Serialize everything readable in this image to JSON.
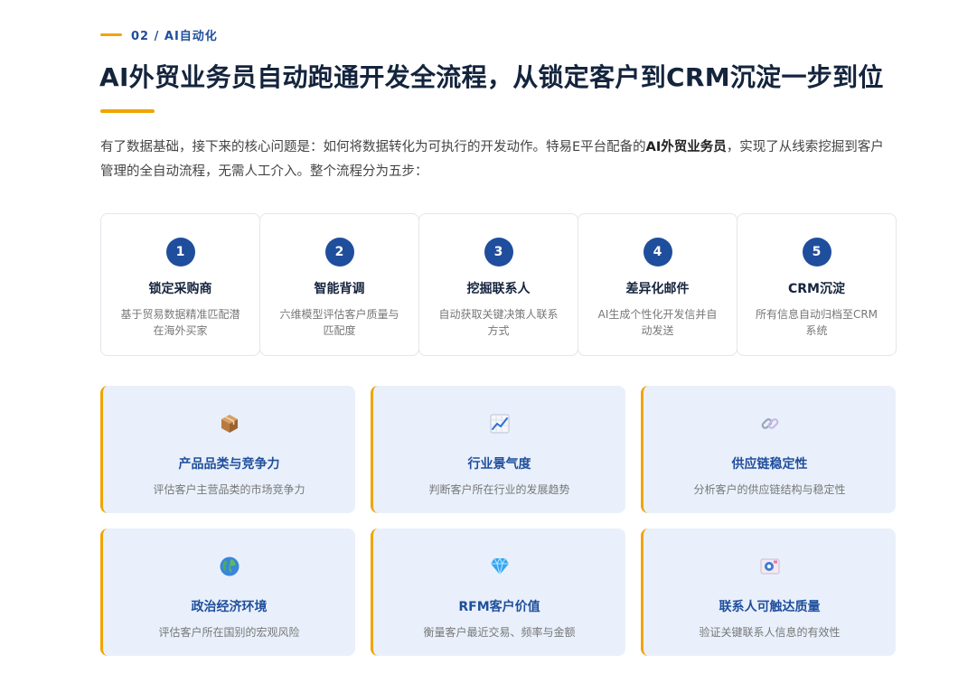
{
  "section": {
    "label": "02 / AI自动化"
  },
  "title": "AI外贸业务员自动跑通开发全流程，从锁定客户到CRM沉淀一步到位",
  "intro": {
    "before": "有了数据基础，接下来的核心问题是：如何将数据转化为可执行的开发动作。特易E平台配备的",
    "bold": "AI外贸业务员",
    "after": "，实现了从线索挖掘到客户管理的全自动流程，无需人工介入。整个流程分为五步："
  },
  "steps": [
    {
      "num": "1",
      "title": "锁定采购商",
      "desc": "基于贸易数据精准匹配潜在海外买家"
    },
    {
      "num": "2",
      "title": "智能背调",
      "desc": "六维模型评估客户质量与匹配度"
    },
    {
      "num": "3",
      "title": "挖掘联系人",
      "desc": "自动获取关键决策人联系方式"
    },
    {
      "num": "4",
      "title": "差异化邮件",
      "desc": "AI生成个性化开发信并自动发送"
    },
    {
      "num": "5",
      "title": "CRM沉淀",
      "desc": "所有信息自动归档至CRM系统"
    }
  ],
  "cards": [
    {
      "icon": "package-icon",
      "title": "产品品类与竞争力",
      "desc": "评估客户主营品类的市场竞争力"
    },
    {
      "icon": "trend-chart-icon",
      "title": "行业景气度",
      "desc": "判断客户所在行业的发展趋势"
    },
    {
      "icon": "chain-link-icon",
      "title": "供应链稳定性",
      "desc": "分析客户的供应链结构与稳定性"
    },
    {
      "icon": "globe-icon",
      "title": "政治经济环境",
      "desc": "评估客户所在国别的宏观风险"
    },
    {
      "icon": "diamond-icon",
      "title": "RFM客户价值",
      "desc": "衡量客户最近交易、频率与金额"
    },
    {
      "icon": "contact-mail-icon",
      "title": "联系人可触达质量",
      "desc": "验证关键联系人信息的有效性"
    }
  ],
  "colors": {
    "accent": "#f0a500",
    "primary": "#1f4e9c",
    "card_bg": "#e9f0fb"
  }
}
